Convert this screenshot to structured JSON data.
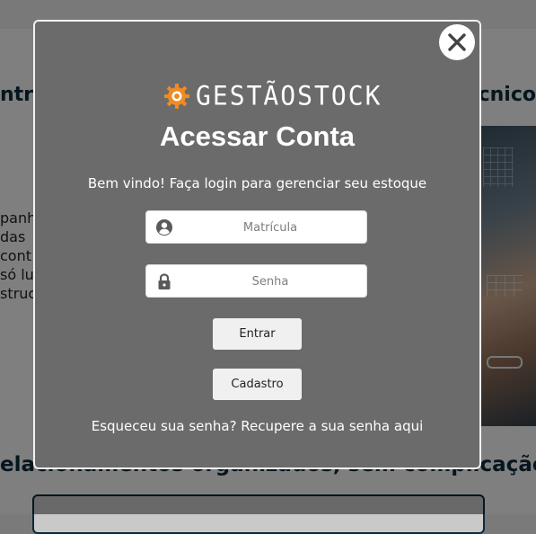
{
  "background": {
    "heading_left": "ntro",
    "heading_right": "cnico",
    "text_lines": [
      "panh",
      "das",
      "cont",
      "só lu",
      "struc"
    ],
    "bottom_heading": "elacionamentos organizados, sem complicação"
  },
  "modal": {
    "logo_text": "GESTÃOSTOCK",
    "title": "Acessar Conta",
    "subtitle": "Bem vindo! Faça login para gerenciar seu estoque",
    "username_placeholder": "Matrícula",
    "password_placeholder": "Senha",
    "login_button": "Entrar",
    "register_button": "Cadastro",
    "forgot_prefix": "Esqueceu sua senha? ",
    "forgot_link": "Recupere a sua senha aqui"
  },
  "colors": {
    "modal_bg": "#6b6b6b",
    "accent_orange": "#f08a24",
    "bg_heading": "#0c2b3a"
  },
  "icons": {
    "close": "close-icon",
    "logo": "gear-icon",
    "username": "user-circle-icon",
    "password": "lock-icon"
  }
}
